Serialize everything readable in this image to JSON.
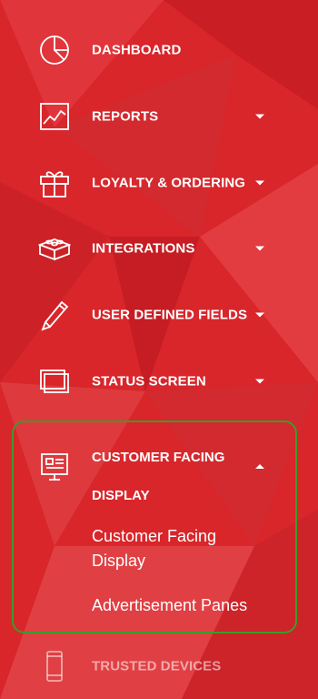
{
  "nav": {
    "items": [
      {
        "label": "DASHBOARD",
        "icon": "pie-chart-icon"
      },
      {
        "label": "REPORTS",
        "icon": "line-chart-icon"
      },
      {
        "label": "LOYALTY & ORDERING",
        "icon": "gift-icon"
      },
      {
        "label": "INTEGRATIONS",
        "icon": "building-blocks-icon"
      },
      {
        "label": "USER DEFINED FIELDS",
        "icon": "pencil-icon"
      },
      {
        "label": "STATUS SCREEN",
        "icon": "windows-icon"
      }
    ],
    "expanded": {
      "label": "CUSTOMER FACING DISPLAY",
      "label_line1": "CUSTOMER FACING",
      "label_line2": "DISPLAY",
      "icon": "presentation-screen-icon",
      "children": [
        "Customer Facing Display",
        "Advertisement Panes"
      ]
    },
    "after": {
      "label": "TRUSTED DEVICES",
      "icon": "mobile-phone-icon"
    }
  },
  "colors": {
    "background": "#d8262b",
    "highlight_border": "#3e9a2a",
    "text": "#ffffff"
  }
}
